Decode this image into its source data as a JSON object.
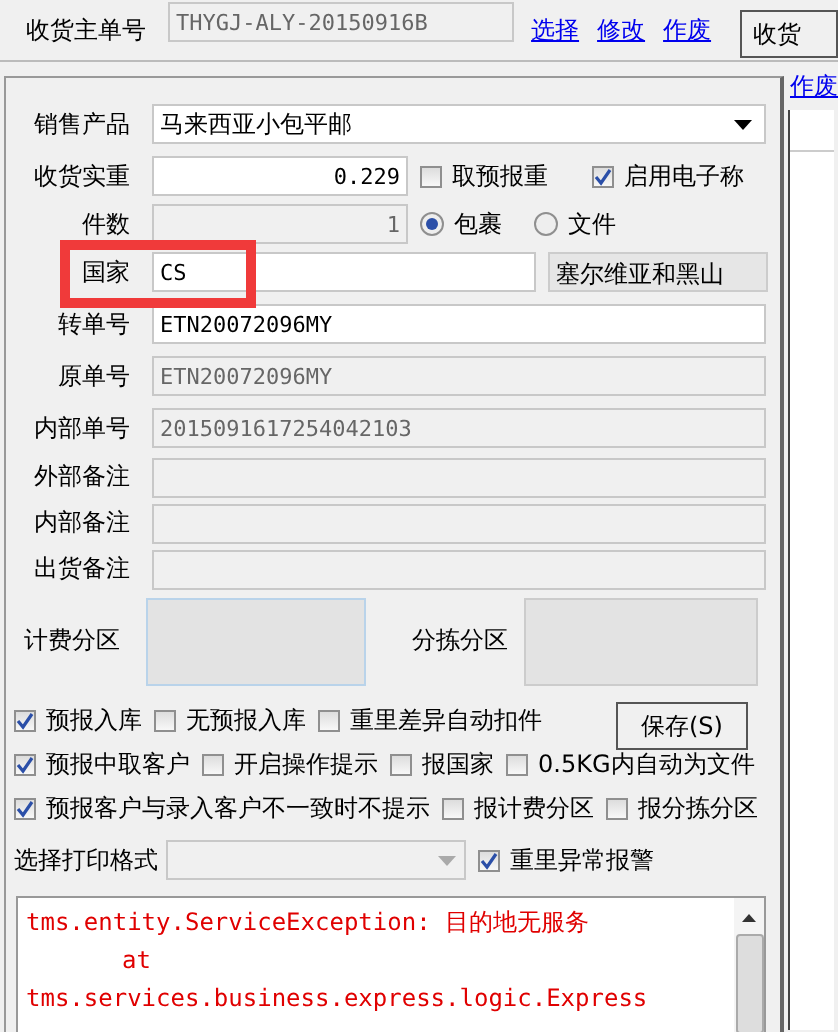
{
  "header": {
    "label": "收货主单号",
    "value": "THYGJ-ALY-20150916B",
    "links": [
      "选择",
      "修改",
      "作废"
    ],
    "button": "收货"
  },
  "side": {
    "link": "作废"
  },
  "product": {
    "label": "销售产品",
    "value": "马来西亚小包平邮"
  },
  "weight": {
    "label": "收货实重",
    "value": "0.229",
    "options": [
      {
        "label": "取预报重",
        "checked": false
      },
      {
        "label": "启用电子称",
        "checked": true
      }
    ]
  },
  "pieces": {
    "label": "件数",
    "value": "1",
    "types": [
      {
        "label": "包裹",
        "selected": true
      },
      {
        "label": "文件",
        "selected": false
      }
    ]
  },
  "country": {
    "label": "国家",
    "value": "CS",
    "name": "塞尔维亚和黑山"
  },
  "fields": [
    {
      "label": "转单号",
      "value": "ETN20072096MY",
      "disabled": false
    },
    {
      "label": "原单号",
      "value": "ETN20072096MY",
      "disabled": true
    },
    {
      "label": "内部单号",
      "value": "2015091617254042103",
      "disabled": true
    },
    {
      "label": "外部备注",
      "disabled": true
    },
    {
      "label": "内部备注",
      "disabled": true
    },
    {
      "label": "出货备注",
      "disabled": true
    }
  ],
  "zones": [
    {
      "label": "计费分区"
    },
    {
      "label": "分拣分区"
    }
  ],
  "save_button": "保存(S)",
  "option_rows": [
    [
      {
        "label": "预报入库",
        "checked": true
      },
      {
        "label": "无预报入库",
        "checked": false
      },
      {
        "label": "重里差异自动扣件",
        "checked": false
      }
    ],
    [
      {
        "label": "预报中取客户",
        "checked": true
      },
      {
        "label": "开启操作提示",
        "checked": false
      },
      {
        "label": "报国家",
        "checked": false
      },
      {
        "label": "0.5KG内自动为文件",
        "checked": false
      }
    ],
    [
      {
        "label": "预报客户与录入客户不一致时不提示",
        "checked": true
      },
      {
        "label": "报计费分区",
        "checked": false
      },
      {
        "label": "报分拣分区",
        "checked": false
      }
    ]
  ],
  "print": {
    "label": "选择打印格式",
    "alarm": {
      "label": "重里异常报警",
      "checked": true
    }
  },
  "error_lines": [
    "tms.entity.ServiceException: 目的地无服务",
    "at",
    "tms.services.business.express.logic.Express"
  ]
}
